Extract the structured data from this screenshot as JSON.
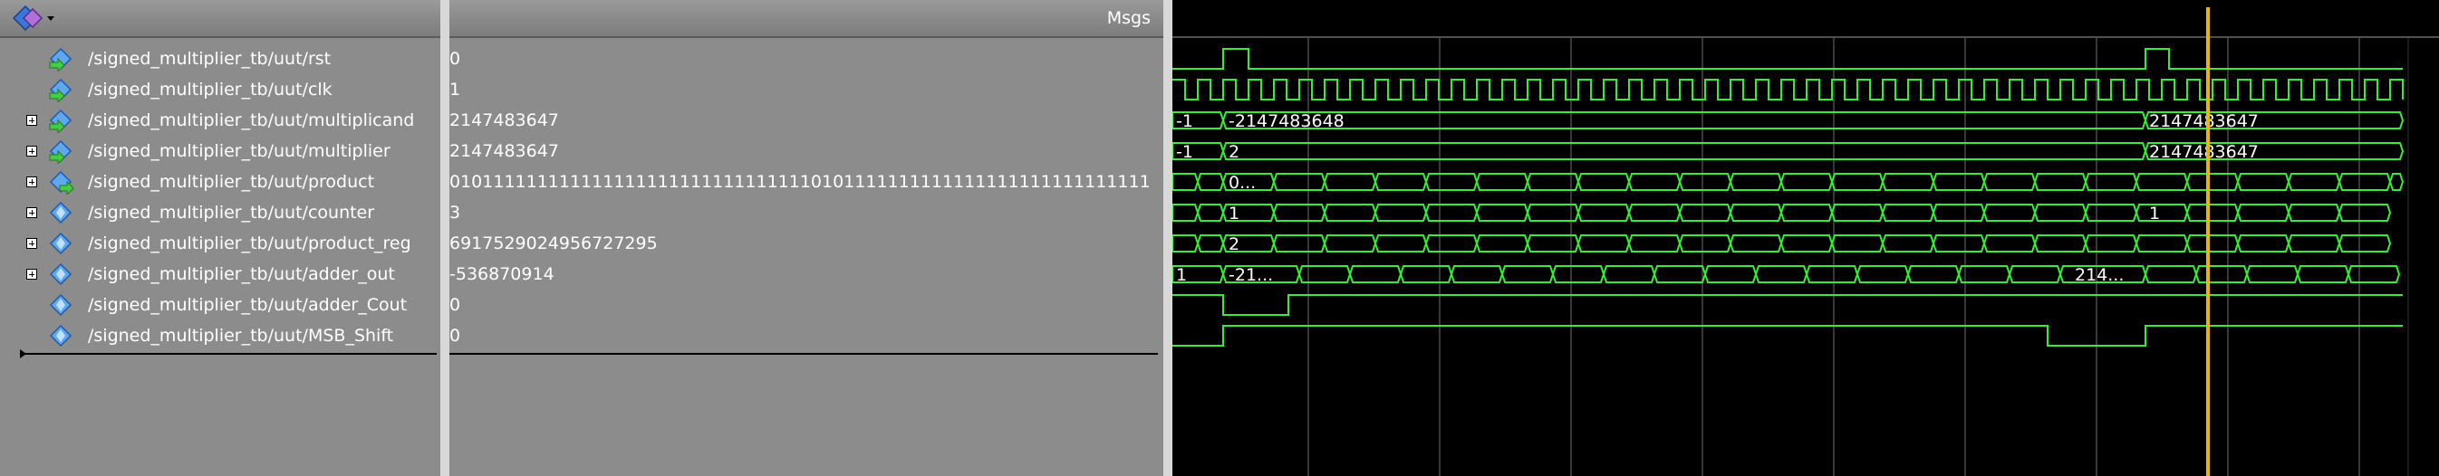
{
  "header": {
    "msgs_label": "Msgs"
  },
  "colors": {
    "wave": "#33ee33",
    "cursor": "#e8b800",
    "grid": "#4a4a4a",
    "background": "#000000"
  },
  "signals": [
    {
      "name": "/signed_multiplier_tb/uut/rst",
      "value": "0",
      "expandable": false,
      "icon": "input-port-icon"
    },
    {
      "name": "/signed_multiplier_tb/uut/clk",
      "value": "1",
      "expandable": false,
      "icon": "input-port-icon"
    },
    {
      "name": "/signed_multiplier_tb/uut/multiplicand",
      "value": "2147483647",
      "expandable": true,
      "icon": "input-port-icon"
    },
    {
      "name": "/signed_multiplier_tb/uut/multiplier",
      "value": "2147483647",
      "expandable": true,
      "icon": "input-port-icon"
    },
    {
      "name": "/signed_multiplier_tb/uut/product",
      "value": "0101111111111111111111111111111110101111111111111111111111111111",
      "expandable": true,
      "icon": "output-port-icon"
    },
    {
      "name": "/signed_multiplier_tb/uut/counter",
      "value": "3",
      "expandable": true,
      "icon": "signal-icon"
    },
    {
      "name": "/signed_multiplier_tb/uut/product_reg",
      "value": "6917529024956727295",
      "expandable": true,
      "icon": "signal-icon"
    },
    {
      "name": "/signed_multiplier_tb/uut/adder_out",
      "value": "-536870914",
      "expandable": true,
      "icon": "signal-icon"
    },
    {
      "name": "/signed_multiplier_tb/uut/adder_Cout",
      "value": "0",
      "expandable": false,
      "icon": "signal-icon"
    },
    {
      "name": "/signed_multiplier_tb/uut/MSB_Shift",
      "value": "0",
      "expandable": false,
      "icon": "signal-icon"
    }
  ],
  "wave_labels": {
    "multiplicand": [
      "-1",
      "-2147483648",
      "2147483647"
    ],
    "multiplier": [
      "-1",
      "2",
      "2147483647"
    ],
    "product": [
      "0..."
    ],
    "counter": [
      "1",
      "1"
    ],
    "product_reg": [
      "2"
    ],
    "adder_out": [
      "1",
      "-21...",
      "214..."
    ]
  }
}
